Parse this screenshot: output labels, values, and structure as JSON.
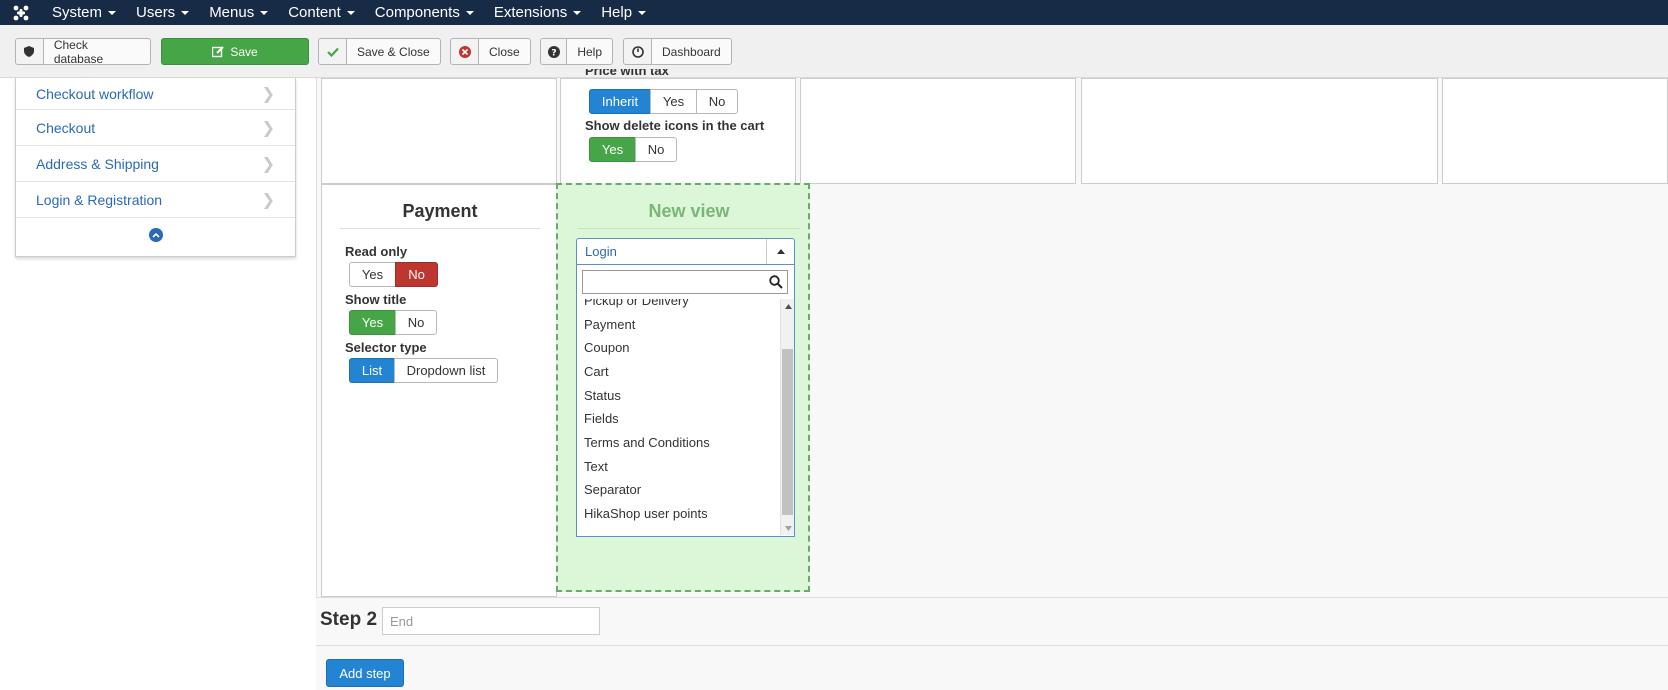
{
  "navbar": {
    "logo_icon": "joomla-logo-icon",
    "menus": [
      "System",
      "Users",
      "Menus",
      "Content",
      "Components",
      "Extensions",
      "Help"
    ]
  },
  "toolbar": {
    "check_database": "Check database",
    "save": "Save",
    "save_close": "Save & Close",
    "close": "Close",
    "help": "Help",
    "dashboard": "Dashboard"
  },
  "sidebar": {
    "items": [
      {
        "label": "Checkout workflow"
      },
      {
        "label": "Checkout"
      },
      {
        "label": "Address & Shipping"
      },
      {
        "label": "Login & Registration"
      }
    ]
  },
  "cart_panel": {
    "price_with_tax_label": "Price with tax",
    "price_with_tax_options": [
      "Inherit",
      "Yes",
      "No"
    ],
    "show_delete_label": "Show delete icons in the cart",
    "show_delete_options": [
      "Yes",
      "No"
    ]
  },
  "payment_panel": {
    "title": "Payment",
    "read_only_label": "Read only",
    "read_only_options": [
      "Yes",
      "No"
    ],
    "show_title_label": "Show title",
    "show_title_options": [
      "Yes",
      "No"
    ],
    "selector_type_label": "Selector type",
    "selector_type_options": [
      "List",
      "Dropdown list"
    ]
  },
  "new_view": {
    "title": "New view",
    "selected": "Login",
    "search_value": "",
    "options": [
      "Pickup or Delivery",
      "Payment",
      "Coupon",
      "Cart",
      "Status",
      "Fields",
      "Terms and Conditions",
      "Text",
      "Separator",
      "HikaShop user points"
    ]
  },
  "step2": {
    "label": "Step 2",
    "placeholder": "End"
  },
  "add_step": "Add step",
  "colors": {
    "navbar": "#172a46",
    "primary": "#2384d3",
    "success": "#46a546",
    "danger": "#bd362f",
    "link": "#2a69b8",
    "dropzone": "#dbf7d7"
  }
}
